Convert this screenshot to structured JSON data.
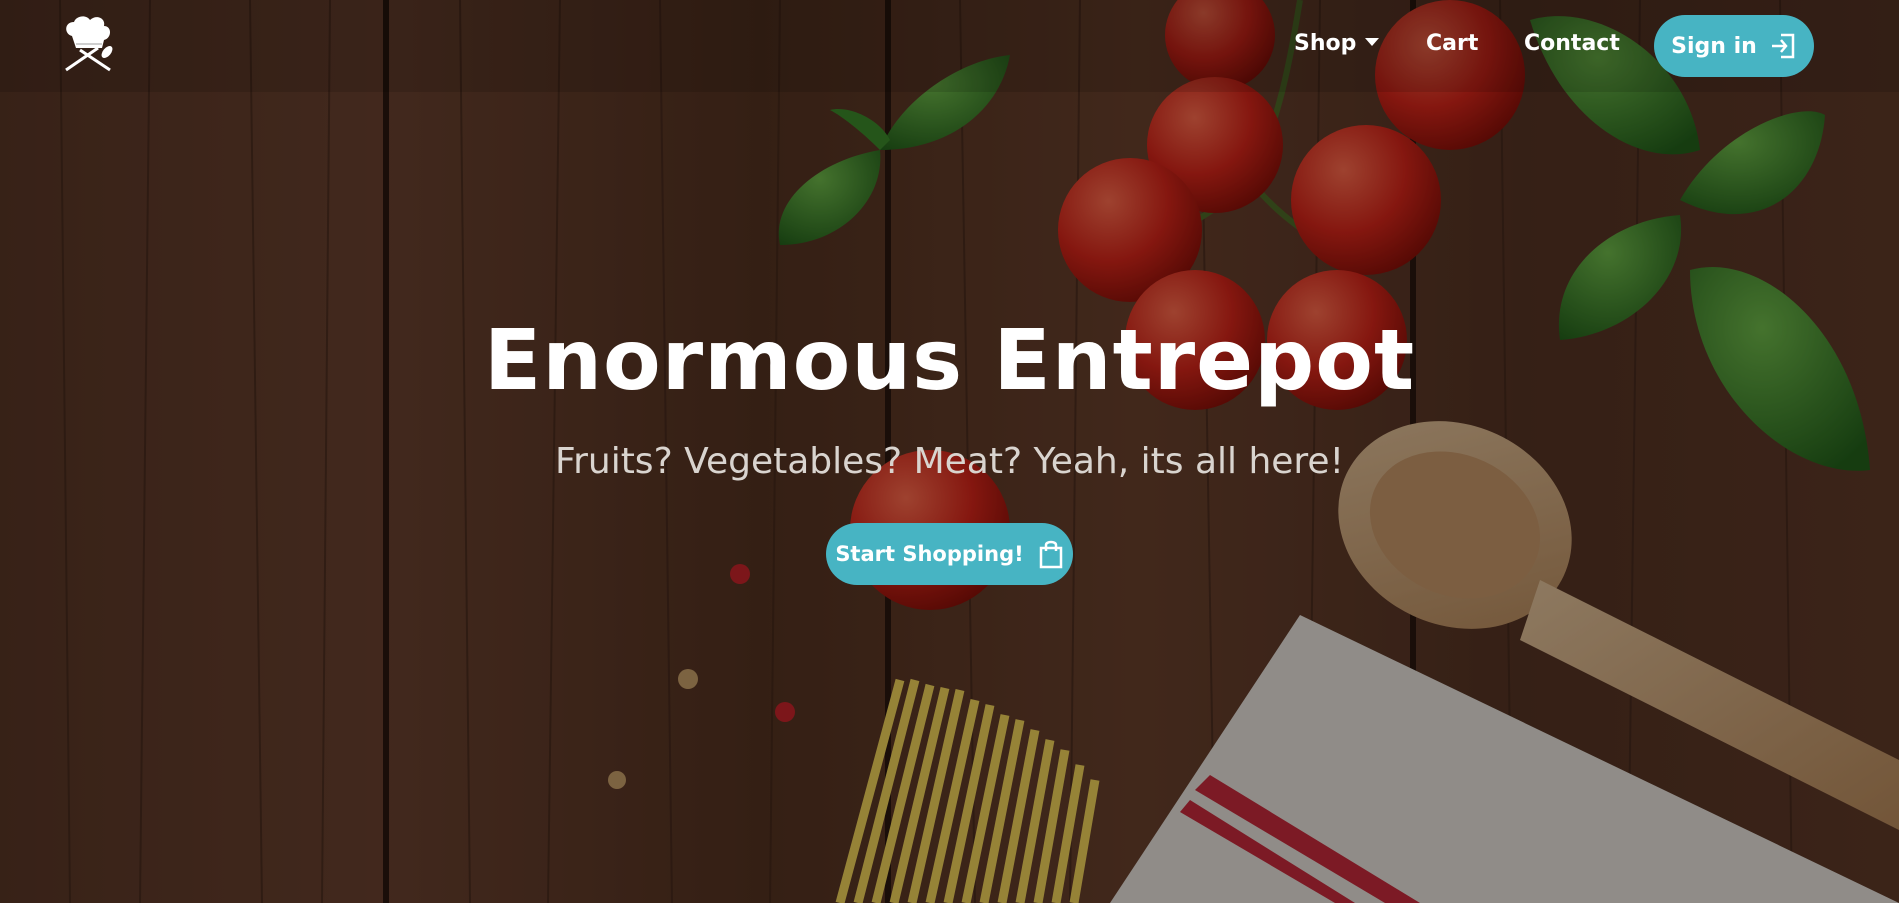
{
  "nav": {
    "logo_icon": "chef-hat-utensils-icon",
    "items": [
      {
        "label": "Shop",
        "has_dropdown": true
      },
      {
        "label": "Cart"
      },
      {
        "label": "Contact"
      }
    ],
    "signin_label": "Sign in",
    "signin_icon": "sign-in-icon"
  },
  "hero": {
    "title": "Enormous Entrepot",
    "subtitle": "Fruits? Vegetables? Meat? Yeah, its all here!",
    "cta_label": "Start Shopping!",
    "cta_icon": "shopping-bag-icon"
  },
  "colors": {
    "accent": "#47b4c3",
    "text": "#ffffff"
  }
}
